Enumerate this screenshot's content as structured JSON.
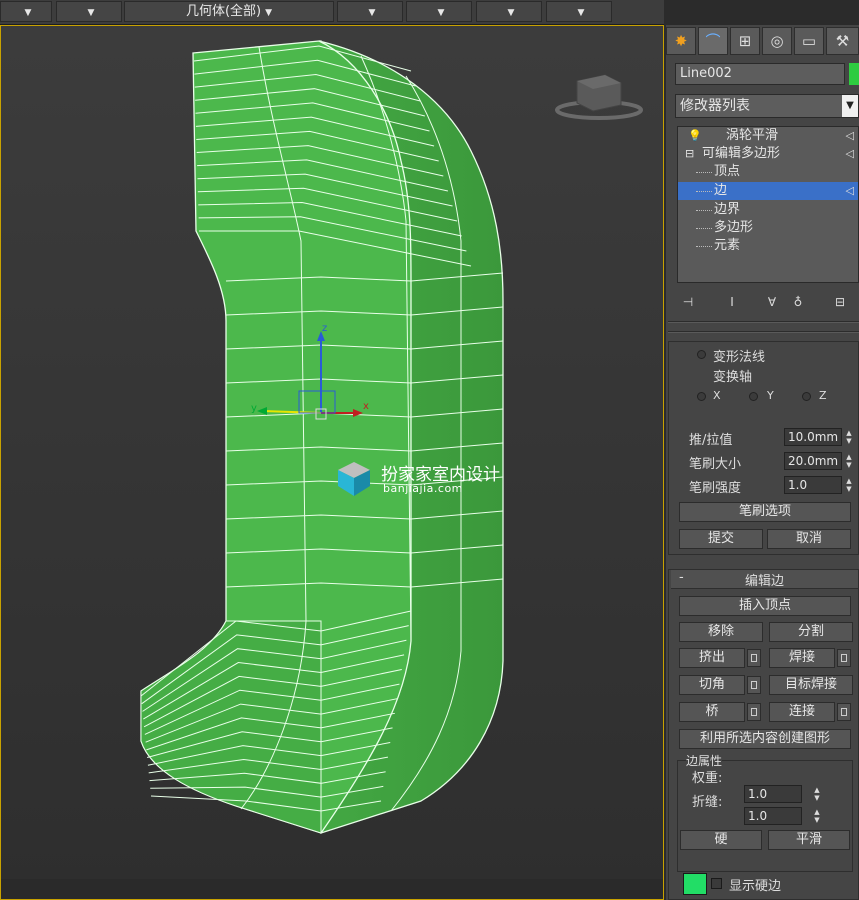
{
  "toolbar": {
    "dropdown_label": "几何体(全部)"
  },
  "panel": {
    "object_name": "Line002",
    "object_color": "#2ecc40",
    "modifier_list": "修改器列表",
    "stack": {
      "turbosmooth": "涡轮平滑",
      "editable_poly": "可编辑多边形",
      "vertex": "顶点",
      "edge": "边",
      "border": "边界",
      "polygon": "多边形",
      "element": "元素"
    },
    "paint_deform": {
      "deform_normal": "变形法线",
      "transform_axis": "变换轴",
      "axis_x": "X",
      "axis_y": "Y",
      "axis_z": "Z",
      "push_pull_label": "推/拉值",
      "push_pull_value": "10.0mm",
      "brush_size_label": "笔刷大小",
      "brush_size_value": "20.0mm",
      "brush_strength_label": "笔刷强度",
      "brush_strength_value": "1.0",
      "brush_options": "笔刷选项",
      "commit": "提交",
      "cancel": "取消"
    },
    "edit_edges": {
      "title": "编辑边",
      "collapse": "-",
      "insert_vertex": "插入顶点",
      "remove": "移除",
      "split": "分割",
      "extrude": "挤出",
      "weld": "焊接",
      "chamfer": "切角",
      "target_weld": "目标焊接",
      "bridge": "桥",
      "connect": "连接",
      "create_shape": "利用所选内容创建图形",
      "edge_props_title": "边属性",
      "weight_label": "权重:",
      "weight_value": "1.0",
      "crease_label": "折缝:",
      "crease_value": "1.0",
      "hard": "硬",
      "smooth": "平滑",
      "show_hard_edges": "显示硬边",
      "hard_edge_color": "#22dd66"
    }
  },
  "viewport": {
    "gizmo": {
      "x": "x",
      "y": "y",
      "z": "z"
    },
    "watermark_title": "扮家家室内设计",
    "watermark_sub": "banjiajia.com",
    "mesh_color": "#4cb84c"
  }
}
